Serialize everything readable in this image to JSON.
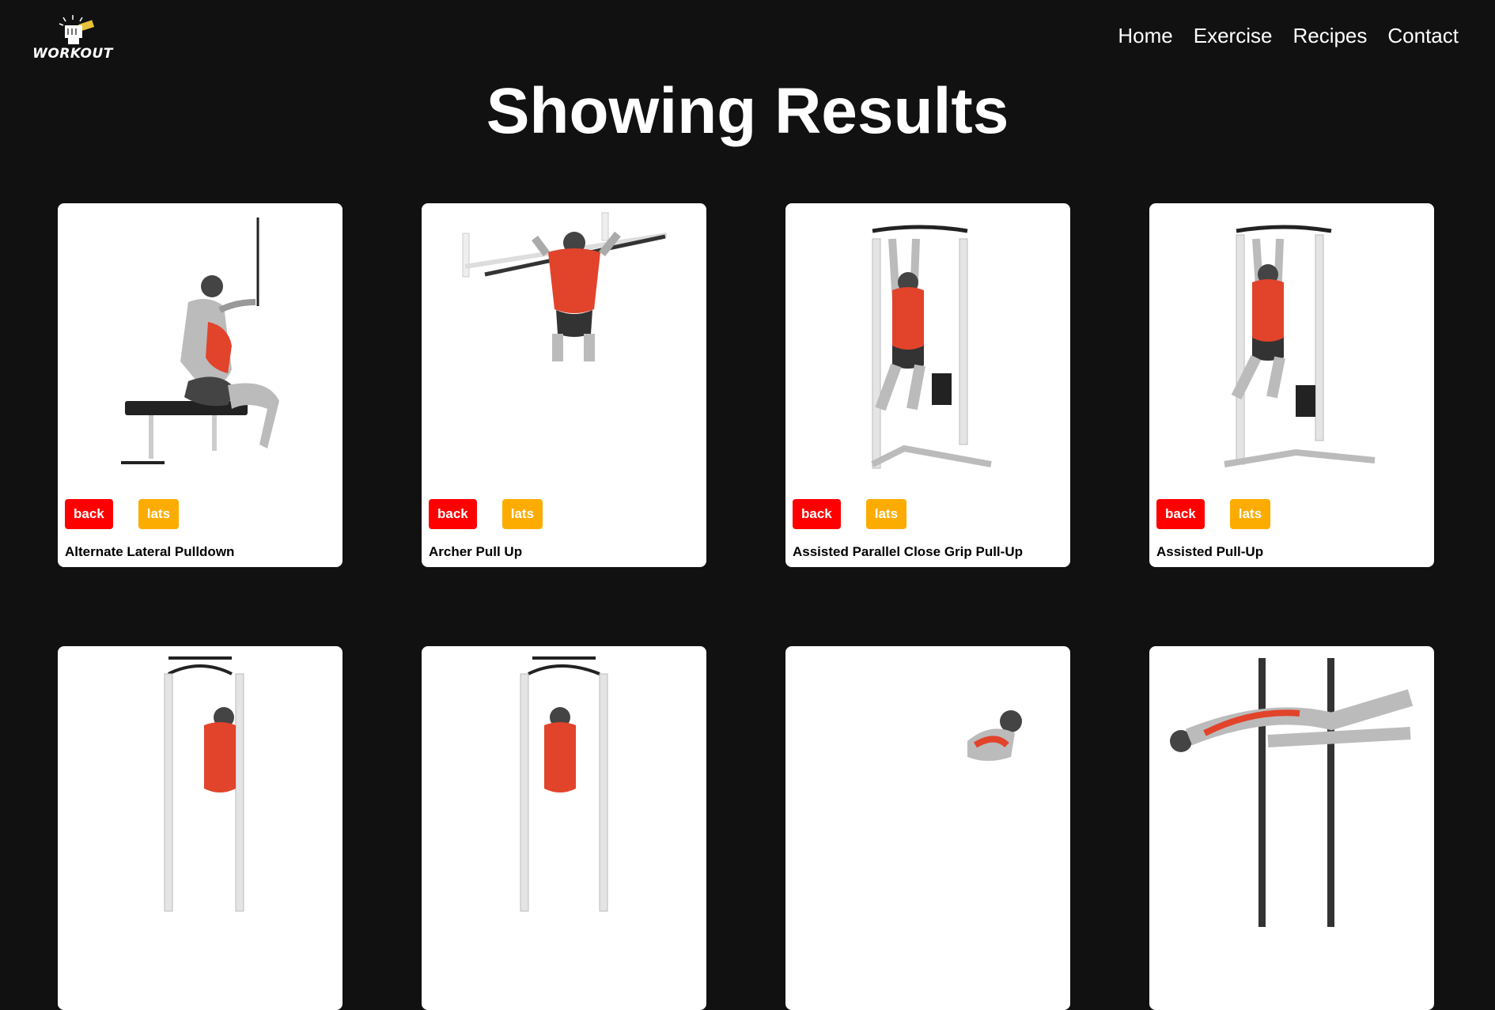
{
  "header": {
    "logo_text": "WORKOUT",
    "nav": [
      "Home",
      "Exercise",
      "Recipes",
      "Contact"
    ]
  },
  "main": {
    "title": "Showing Results",
    "cards": [
      {
        "name": "Alternate Lateral Pulldown",
        "tags": [
          "back",
          "lats"
        ],
        "illustration": "seated-cable-pulldown"
      },
      {
        "name": "Archer Pull Up",
        "tags": [
          "back",
          "lats"
        ],
        "illustration": "pull-up-bar"
      },
      {
        "name": "Assisted Parallel Close Grip Pull-Up",
        "tags": [
          "back",
          "lats"
        ],
        "illustration": "assisted-pullup-machine"
      },
      {
        "name": "Assisted Pull-Up",
        "tags": [
          "back",
          "lats"
        ],
        "illustration": "assisted-pullup-machine"
      },
      {
        "name": "",
        "tags": [],
        "illustration": "pullup-machine"
      },
      {
        "name": "",
        "tags": [],
        "illustration": "pullup-machine"
      },
      {
        "name": "",
        "tags": [],
        "illustration": "floor-exercise"
      },
      {
        "name": "",
        "tags": [],
        "illustration": "inverted-row"
      }
    ]
  },
  "colors": {
    "background": "#111111",
    "tag_back": "#ff0000",
    "tag_lats": "#fcac00",
    "card": "#ffffff"
  }
}
